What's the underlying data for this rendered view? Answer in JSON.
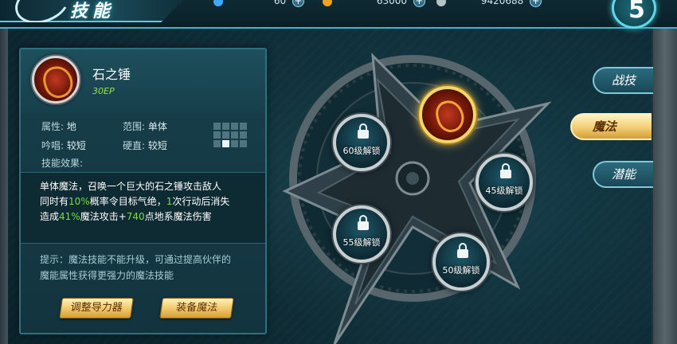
{
  "header": {
    "title": "技能",
    "resources": [
      {
        "name": "diamond",
        "value": "60",
        "color": "#3fa9ff"
      },
      {
        "name": "gold",
        "value": "63000",
        "color": "#f0a21c"
      },
      {
        "name": "silver",
        "value": "9420688",
        "color": "#b7c2c6"
      }
    ],
    "plus": "+",
    "back_glyph": "5"
  },
  "skill": {
    "name": "石之锤",
    "ep": "30EP",
    "attr_label": "属性:",
    "attr_value": "地",
    "range_label": "范围:",
    "range_value": "单体",
    "chant_label": "吟唱:",
    "chant_value": "较短",
    "stiff_label": "硬直:",
    "stiff_value": "较短",
    "effect_label": "技能效果:",
    "effect": {
      "l1": "单体魔法，召唤一个巨大的石之锤攻击敌人",
      "l2a": "同时有",
      "l2b": "10%",
      "l2c": "概率令目标气绝，",
      "l2d": "1",
      "l2e": "次行动后消失",
      "l3a": "造成",
      "l3b": "41%",
      "l3c": "魔法攻击+",
      "l3d": "740",
      "l3e": "点地系魔法伤害"
    },
    "tip_l1": "提示：魔法技能不能升级，可通过提高伙伴的",
    "tip_l2": "魔能属性获得更强力的魔法技能",
    "adjust_button": "调整导力器",
    "equip_button": "装备魔法",
    "highlight_color": "#78df3a"
  },
  "wheel": {
    "slots": [
      {
        "label": "",
        "state": "equipped"
      },
      {
        "label": "45级解锁",
        "state": "locked"
      },
      {
        "label": "50级解锁",
        "state": "locked"
      },
      {
        "label": "55级解锁",
        "state": "locked"
      },
      {
        "label": "60级解锁",
        "state": "locked"
      }
    ]
  },
  "tabs": [
    {
      "label": "战技",
      "active": false
    },
    {
      "label": "魔法",
      "active": true
    },
    {
      "label": "潜能",
      "active": false
    }
  ]
}
